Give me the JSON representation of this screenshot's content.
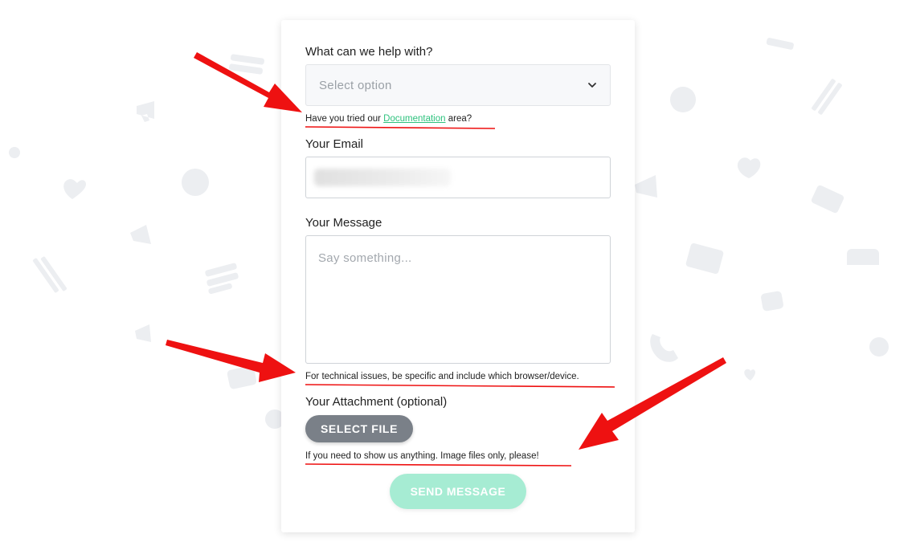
{
  "form": {
    "help_label": "What can we help with?",
    "select_placeholder": "Select option",
    "docs_hint_prefix": "Have you tried our ",
    "docs_link": "Documentation",
    "docs_hint_suffix": " area?",
    "email_label": "Your Email",
    "message_label": "Your Message",
    "message_placeholder": "Say something...",
    "message_hint": "For technical issues, be specific and include which browser/device.",
    "attachment_label": "Your Attachment (optional)",
    "select_file_button": "SELECT FILE",
    "attachment_hint": "If you need to show us anything. Image files only, please!",
    "send_button": "SEND MESSAGE"
  },
  "colors": {
    "link": "#2ec27e",
    "send_button": "#a6ecd3",
    "file_button": "#7a8088",
    "annotation": "#ee1111"
  },
  "icons": [
    "chevron-down-icon",
    "megaphone-icon",
    "question-icon",
    "heart-icon",
    "envelope-icon",
    "phone-icon",
    "chat-bubble-icon",
    "ticket-icon",
    "mailbox-icon",
    "books-icon"
  ]
}
